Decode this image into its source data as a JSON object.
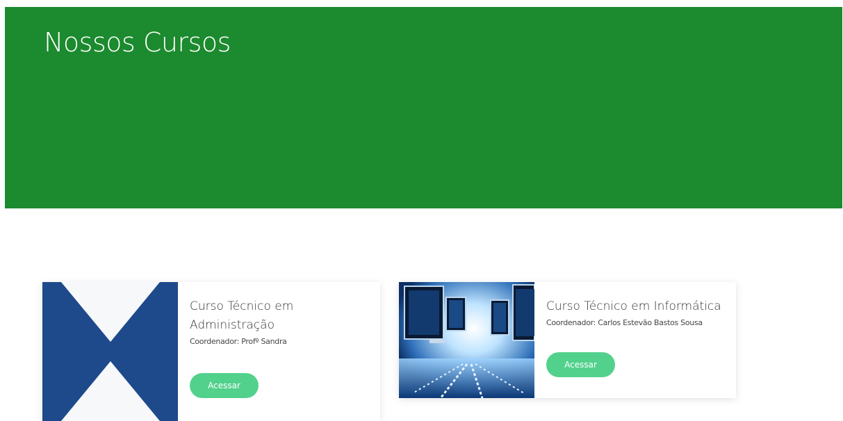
{
  "hero": {
    "title": "Nossos Cursos",
    "background_color": "#1c8a2e"
  },
  "courses": [
    {
      "title": "Curso Técnico em Administração",
      "coordinator": "Coordenador: Profº Sandra",
      "button_label": "Acessar",
      "image": "administration-logo-blue-x"
    },
    {
      "title": "Curso Técnico em Informática",
      "coordinator": "Coordenador: Carlos Estevão Bastos Sousa",
      "button_label": "Acessar",
      "image": "computer-monitors-binary-data"
    }
  ],
  "colors": {
    "accent_button": "#52d18c",
    "admin_logo_blue": "#1e4a8c"
  }
}
